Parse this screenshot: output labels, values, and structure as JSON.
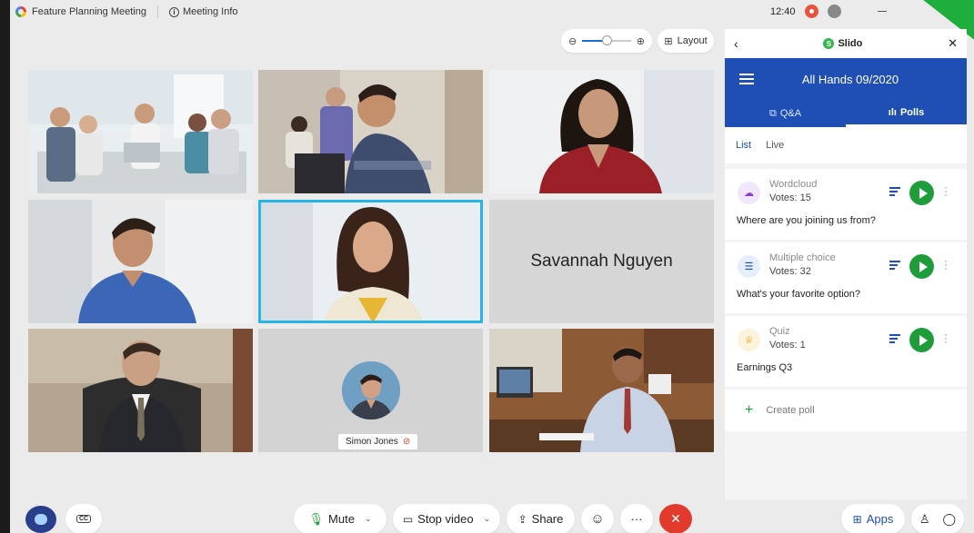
{
  "titlebar": {
    "meeting_title": "Feature Planning Meeting",
    "info_label": "Meeting Info",
    "clock": "12:40"
  },
  "toolbar": {
    "layout_label": "Layout",
    "zoom_level": 0.5
  },
  "participants": {
    "named_tile": "Savannah Nguyen",
    "avatar_tile": "Simon Jones"
  },
  "slido": {
    "title": "Slido",
    "event_name": "All Hands 09/2020",
    "tabs": [
      {
        "label": "Q&A",
        "icon": "qa-icon"
      },
      {
        "label": "Polls",
        "icon": "bar-chart-icon"
      }
    ],
    "subtabs": [
      "List",
      "Live"
    ],
    "polls": [
      {
        "type": "Wordcloud",
        "votes": "Votes: 15",
        "question": "Where are you joining us from?",
        "icon": "cloud-icon",
        "icon_bg": "#f1e6fb",
        "icon_color": "#8b3fc9"
      },
      {
        "type": "Multiple choice",
        "votes": "Votes: 32",
        "question": "What's your favorite option?",
        "icon": "list-icon",
        "icon_bg": "#e6eefc",
        "icon_color": "#1f4fb4"
      },
      {
        "type": "Quiz",
        "votes": "Votes: 1",
        "question": "Earnings Q3",
        "icon": "trophy-icon",
        "icon_bg": "#fdf3dc",
        "icon_color": "#d8a21c"
      }
    ],
    "create_poll": "Create poll"
  },
  "bottom": {
    "mute": "Mute",
    "stop_video": "Stop video",
    "share": "Share",
    "more": "···",
    "apps": "Apps"
  },
  "colors": {
    "accent_blue": "#1f4fb4",
    "play_green": "#1f9d3a",
    "end_red": "#e23b2e",
    "active_border": "#27b4e8"
  }
}
